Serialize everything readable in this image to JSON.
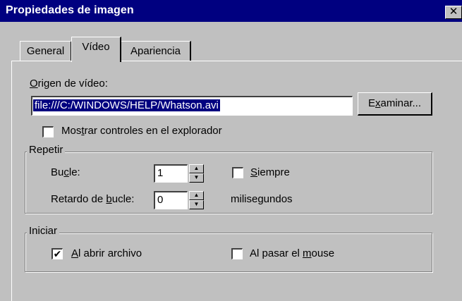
{
  "window": {
    "title": "Propiedades de imagen",
    "close_label": "✕"
  },
  "tabs": [
    {
      "label": "General",
      "active": false
    },
    {
      "label": "Vídeo",
      "active": true
    },
    {
      "label": "Apariencia",
      "active": false
    }
  ],
  "video_source": {
    "label_mnemonic": "O",
    "label_rest": "rigen de vídeo:",
    "value": "file:///C:/WINDOWS/HELP/Whatson.avi",
    "browse_pre": "E",
    "browse_mnemonic": "x",
    "browse_post": "aminar..."
  },
  "show_controls": {
    "pre": "Mos",
    "mnemonic": "t",
    "post": "rar controles en el explorador",
    "checked": false
  },
  "repeat": {
    "legend": "Repetir",
    "loop_pre": "Bu",
    "loop_mnemonic": "c",
    "loop_post": "le:",
    "loop_value": "1",
    "always_mnemonic": "S",
    "always_rest": "iempre",
    "always_checked": false,
    "delay_pre": "Retardo de ",
    "delay_mnemonic": "b",
    "delay_post": "ucle:",
    "delay_value": "0",
    "delay_unit": "milisegundos"
  },
  "start": {
    "legend": "Iniciar",
    "open_mnemonic": "A",
    "open_rest": "l abrir archivo",
    "open_checked": true,
    "hover_pre": "Al pasar el ",
    "hover_mnemonic": "m",
    "hover_post": "ouse",
    "hover_checked": false
  }
}
